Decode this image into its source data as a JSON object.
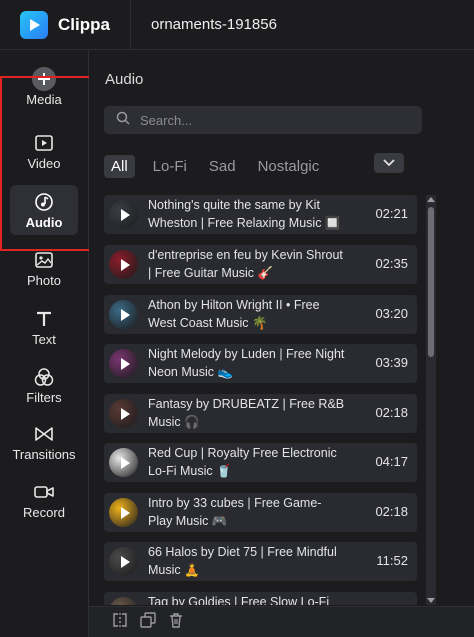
{
  "app": {
    "name": "Clippa",
    "project_name": "ornaments-191856"
  },
  "nav": [
    {
      "id": "media",
      "label": "Media",
      "icon": "plus-circle-icon",
      "active": false
    },
    {
      "id": "video",
      "label": "Video",
      "icon": "video-play-icon",
      "active": false
    },
    {
      "id": "audio",
      "label": "Audio",
      "icon": "music-note-icon",
      "active": true
    },
    {
      "id": "photo",
      "label": "Photo",
      "icon": "image-icon",
      "active": false
    },
    {
      "id": "text",
      "label": "Text",
      "icon": "text-t-icon",
      "active": false
    },
    {
      "id": "filters",
      "label": "Filters",
      "icon": "filters-circles-icon",
      "active": false
    },
    {
      "id": "transitions",
      "label": "Transitions",
      "icon": "bowtie-icon",
      "active": false
    },
    {
      "id": "record",
      "label": "Record",
      "icon": "camera-icon",
      "active": false
    }
  ],
  "panel": {
    "title": "Audio",
    "search_placeholder": "Search...",
    "filters": [
      "All",
      "Lo-Fi",
      "Sad",
      "Nostalgic"
    ],
    "active_filter": "All"
  },
  "tracks": [
    {
      "title_line1": "Nothing's quite the same by Kit",
      "title_line2": "Wheston | Free Relaxing Music 🔲",
      "duration": "02:21",
      "thumb_color": "#3a3f44"
    },
    {
      "title_line1": "d'entreprise en feu by Kevin Shrout",
      "title_line2": "| Free Guitar Music 🎸",
      "duration": "02:35",
      "thumb_color": "#8c1d2a"
    },
    {
      "title_line1": "Athon by Hilton Wright II • Free",
      "title_line2": "West Coast Music 🌴",
      "duration": "03:20",
      "thumb_color": "#3c6a86"
    },
    {
      "title_line1": "Night Melody by Luden | Free Night",
      "title_line2": "Neon Music 👟",
      "duration": "03:39",
      "thumb_color": "#7a3570"
    },
    {
      "title_line1": "Fantasy by DRUBEATZ | Free R&B",
      "title_line2": "Music 🎧",
      "duration": "02:18",
      "thumb_color": "#5a3a34"
    },
    {
      "title_line1": "Red Cup | Royalty Free Electronic",
      "title_line2": "Lo-Fi Music 🥤",
      "duration": "04:17",
      "thumb_color": "#e8e8e8"
    },
    {
      "title_line1": "Intro by 33 cubes | Free Game-",
      "title_line2": "Play Music 🎮",
      "duration": "02:18",
      "thumb_color": "#f0b21b"
    },
    {
      "title_line1": "66 Halos by Diet 75 | Free Mindful",
      "title_line2": "Music 🧘",
      "duration": "11:52",
      "thumb_color": "#4a4a4a"
    },
    {
      "title_line1": "Tag by Goldies | Free Slow Lo-Fi",
      "title_line2": "",
      "duration": "",
      "thumb_color": "#6a5a4a"
    }
  ],
  "colors": {
    "accent_start": "#27c5f7",
    "accent_end": "#2a7df4",
    "highlight_border": "#e02424",
    "background": "#1c1c1f",
    "card": "#2a2b30"
  }
}
